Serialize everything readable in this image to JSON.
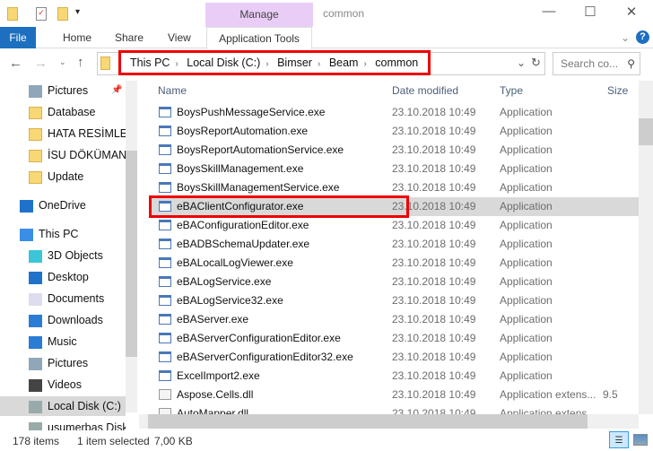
{
  "window": {
    "title": "common",
    "context_tab": "Manage",
    "minimize": "—",
    "maximize": "☐",
    "close": "✕"
  },
  "ribbon": {
    "tabs": [
      "File",
      "Home",
      "Share",
      "View",
      "Application Tools"
    ],
    "expand": "⌄",
    "help": "?"
  },
  "address": {
    "crumbs": [
      "This PC",
      "Local Disk (C:)",
      "Bimser",
      "Beam",
      "common"
    ],
    "search_placeholder": "Search co..."
  },
  "nav": {
    "items": [
      {
        "label": "Pictures",
        "icon": "pictures-icon",
        "pinned": true
      },
      {
        "label": "Database",
        "icon": "folder-icon"
      },
      {
        "label": "HATA RESİMLER",
        "icon": "folder-icon"
      },
      {
        "label": "İSU DÖKÜMANL",
        "icon": "folder-icon"
      },
      {
        "label": "Update",
        "icon": "folder-icon"
      },
      {
        "label": "OneDrive",
        "icon": "onedrive-icon"
      },
      {
        "label": "This PC",
        "icon": "pc-icon"
      },
      {
        "label": "3D Objects",
        "icon": "3d-icon"
      },
      {
        "label": "Desktop",
        "icon": "desktop-icon"
      },
      {
        "label": "Documents",
        "icon": "documents-icon"
      },
      {
        "label": "Downloads",
        "icon": "downloads-icon"
      },
      {
        "label": "Music",
        "icon": "music-icon"
      },
      {
        "label": "Pictures",
        "icon": "pictures-icon"
      },
      {
        "label": "Videos",
        "icon": "videos-icon"
      },
      {
        "label": "Local Disk (C:)",
        "icon": "disk-icon",
        "selected": true
      },
      {
        "label": "usumerbas Disk",
        "icon": "disk-icon"
      }
    ]
  },
  "columns": [
    "Name",
    "Date modified",
    "Type",
    "Size"
  ],
  "files": [
    {
      "name": "BoysPushMessageService.exe",
      "date": "23.10.2018 10:49",
      "type": "Application",
      "size": ""
    },
    {
      "name": "BoysReportAutomation.exe",
      "date": "23.10.2018 10:49",
      "type": "Application",
      "size": ""
    },
    {
      "name": "BoysReportAutomationService.exe",
      "date": "23.10.2018 10:49",
      "type": "Application",
      "size": ""
    },
    {
      "name": "BoysSkillManagement.exe",
      "date": "23.10.2018 10:49",
      "type": "Application",
      "size": ""
    },
    {
      "name": "BoysSkillManagementService.exe",
      "date": "23.10.2018 10:49",
      "type": "Application",
      "size": ""
    },
    {
      "name": "eBAClientConfigurator.exe",
      "date": "23.10.2018 10:49",
      "type": "Application",
      "size": "",
      "selected": true
    },
    {
      "name": "eBAConfigurationEditor.exe",
      "date": "23.10.2018 10:49",
      "type": "Application",
      "size": ""
    },
    {
      "name": "eBADBSchemaUpdater.exe",
      "date": "23.10.2018 10:49",
      "type": "Application",
      "size": ""
    },
    {
      "name": "eBALocalLogViewer.exe",
      "date": "23.10.2018 10:49",
      "type": "Application",
      "size": ""
    },
    {
      "name": "eBALogService.exe",
      "date": "23.10.2018 10:49",
      "type": "Application",
      "size": ""
    },
    {
      "name": "eBALogService32.exe",
      "date": "23.10.2018 10:49",
      "type": "Application",
      "size": ""
    },
    {
      "name": "eBAServer.exe",
      "date": "23.10.2018 10:49",
      "type": "Application",
      "size": ""
    },
    {
      "name": "eBAServerConfigurationEditor.exe",
      "date": "23.10.2018 10:49",
      "type": "Application",
      "size": ""
    },
    {
      "name": "eBAServerConfigurationEditor32.exe",
      "date": "23.10.2018 10:49",
      "type": "Application",
      "size": ""
    },
    {
      "name": "ExcelImport2.exe",
      "date": "23.10.2018 10:49",
      "type": "Application",
      "size": ""
    },
    {
      "name": "Aspose.Cells.dll",
      "date": "23.10.2018 10:49",
      "type": "Application extens...",
      "size": "9.5"
    },
    {
      "name": "AutoMapper.dll",
      "date": "23.10.2018 10:49",
      "type": "Application extens...",
      "size": ""
    }
  ],
  "status": {
    "count": "178 items",
    "selected": "1 item selected",
    "size": "7,00 KB"
  }
}
